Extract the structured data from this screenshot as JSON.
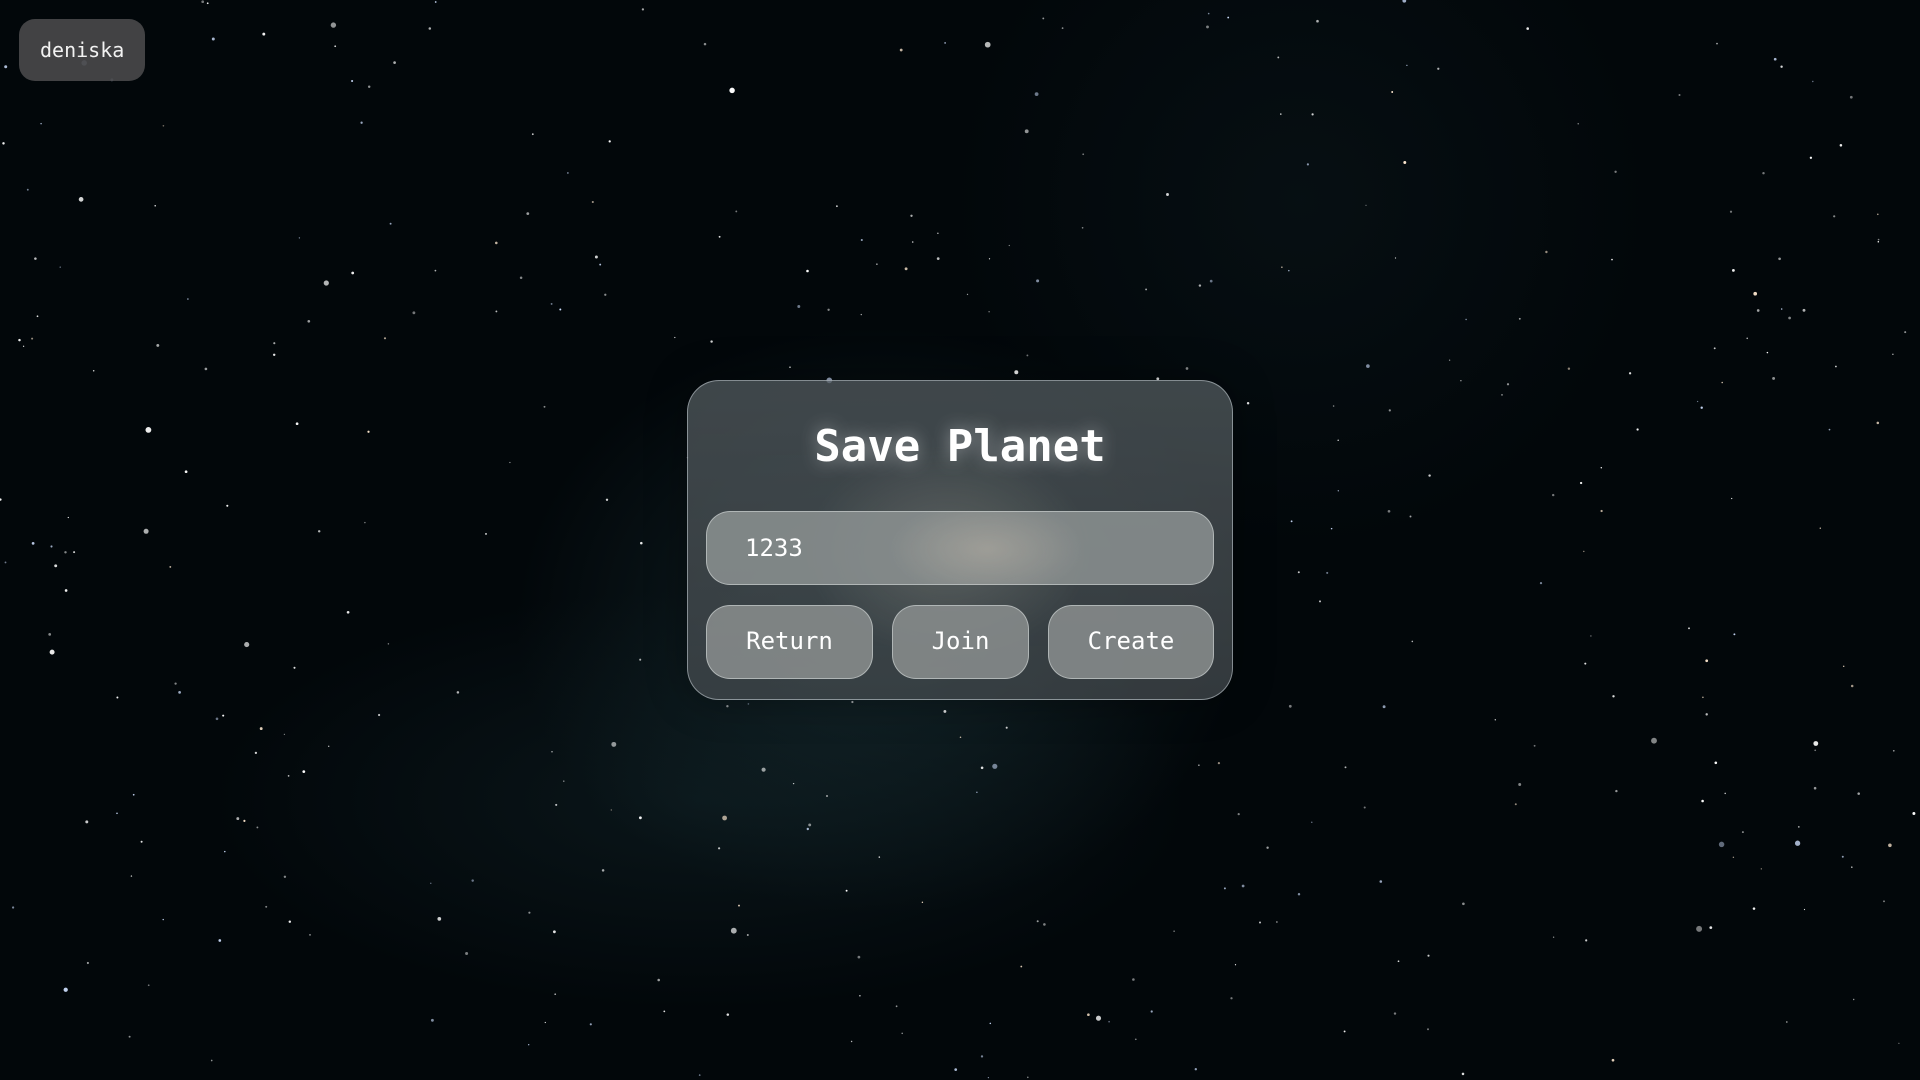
{
  "user": {
    "name": "deniska"
  },
  "dialog": {
    "title": "Save Planet",
    "code_value": "1233",
    "buttons": {
      "return": "Return",
      "join": "Join",
      "create": "Create"
    }
  },
  "colors": {
    "background": "#02070a",
    "panel": "#505a5e",
    "control": "#878c8c",
    "text": "#ffffff"
  }
}
